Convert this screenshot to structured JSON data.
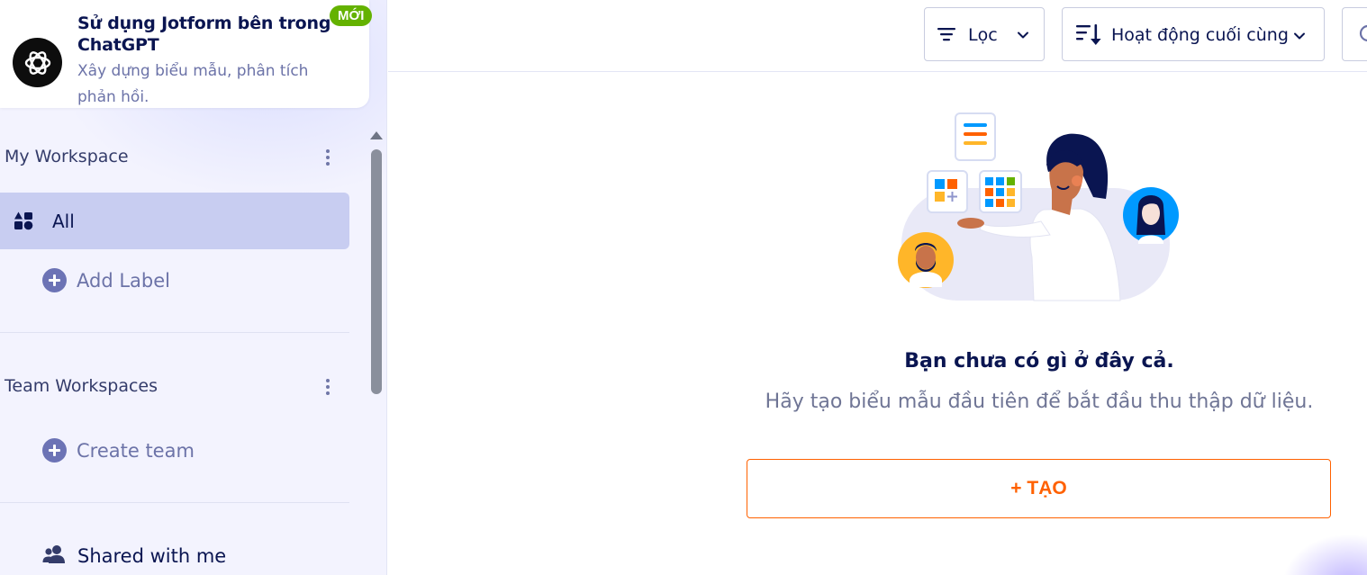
{
  "promo": {
    "title": "Sử dụng Jotform bên trong ChatGPT",
    "description": "Xây dựng biểu mẫu, phân tích phản hồi.",
    "badge": "MỚI",
    "logo_icon": "openai-logo-icon"
  },
  "sidebar": {
    "my_workspace": {
      "title": "My Workspace",
      "items": [
        {
          "label": "All",
          "icon": "grid-shapes-icon",
          "active": true
        },
        {
          "label": "Add Label",
          "icon": "plus-circle-icon"
        }
      ]
    },
    "team_workspaces": {
      "title": "Team Workspaces",
      "items": [
        {
          "label": "Create team",
          "icon": "plus-circle-icon"
        }
      ]
    },
    "shared": {
      "label": "Shared with me",
      "icon": "users-icon"
    }
  },
  "toolbar": {
    "filter_label": "Lọc",
    "sort_label": "Hoạt động cuối cùng",
    "search_icon": "search-icon"
  },
  "empty_state": {
    "title": "Bạn chưa có gì ở đây cả.",
    "subtitle": "Hãy tạo biểu mẫu đầu tiên để bắt đầu thu thập dữ liệu.",
    "create_label": "+ TẠO"
  },
  "colors": {
    "brand_navy": "#0a1551",
    "accent_orange": "#ff6100",
    "badge_green": "#64b200",
    "sidebar_bg": "#f3f3fe",
    "active_item_bg": "#c8cdf1"
  }
}
